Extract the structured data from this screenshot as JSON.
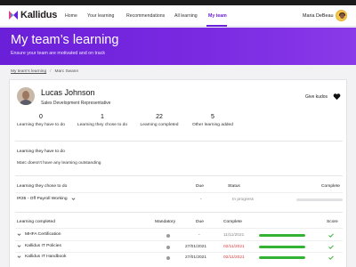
{
  "app": {
    "brand": "Kallidus"
  },
  "nav": {
    "items": [
      {
        "label": "Home"
      },
      {
        "label": "Your learning"
      },
      {
        "label": "Recommendations"
      },
      {
        "label": "All learning"
      },
      {
        "label": "My team",
        "active": true
      }
    ]
  },
  "user": {
    "name": "Maria DeBeau"
  },
  "hero": {
    "title": "My team’s learning",
    "subtitle": "Ensure your team are motivated and on track"
  },
  "breadcrumb": {
    "parent": "My team's learning",
    "current": "Marc Swann"
  },
  "person": {
    "name": "Lucas Johnson",
    "role": "Sales Development Representative",
    "kudos_label": "Give kudos"
  },
  "stats": [
    {
      "value": "0",
      "label": "Learning they have to do"
    },
    {
      "value": "1",
      "label": "Learning they chose to do"
    },
    {
      "value": "22",
      "label": "Learning completed"
    },
    {
      "value": "5",
      "label": "Other learning added"
    }
  ],
  "have_to_do": {
    "title": "Learning they have to do",
    "empty_text": "Marc doesn't have any learning outstanding"
  },
  "chose_to_do": {
    "title": "Learning they chose to do",
    "headers": {
      "due": "Due",
      "status": "Status",
      "complete": "Complete"
    },
    "rows": [
      {
        "name": "IR35 - Off Payroll Working",
        "due": "-",
        "status": "In progress",
        "progress": 0.0
      }
    ]
  },
  "completed": {
    "title": "Learning completed",
    "headers": {
      "mandatory": "Mandatory",
      "due": "Due",
      "complete": "Complete",
      "score": "Score"
    },
    "rows": [
      {
        "name": "MHFA Certification",
        "mandatory": true,
        "due": "-",
        "complete": "11/11/2021",
        "complete_color": "#888888",
        "progress": 1.0
      },
      {
        "name": "Kallidus IT Policies",
        "mandatory": true,
        "due": "27/01/2021",
        "complete": "02/11/2021",
        "complete_color": "#d63c3c",
        "progress": 1.0
      },
      {
        "name": "Kallidus IT Handbook",
        "mandatory": true,
        "due": "27/01/2021",
        "complete": "02/11/2021",
        "complete_color": "#d63c3c",
        "progress": 1.0
      }
    ]
  },
  "colors": {
    "accent": "#6a1fd8",
    "progress": "#34b233",
    "overdue": "#d63c3c",
    "check": "#34b233"
  },
  "icons": {
    "logo": "kallidus-logo-icon",
    "heart": "heart-icon",
    "chevron": "chevron-down-icon",
    "check": "check-icon"
  }
}
